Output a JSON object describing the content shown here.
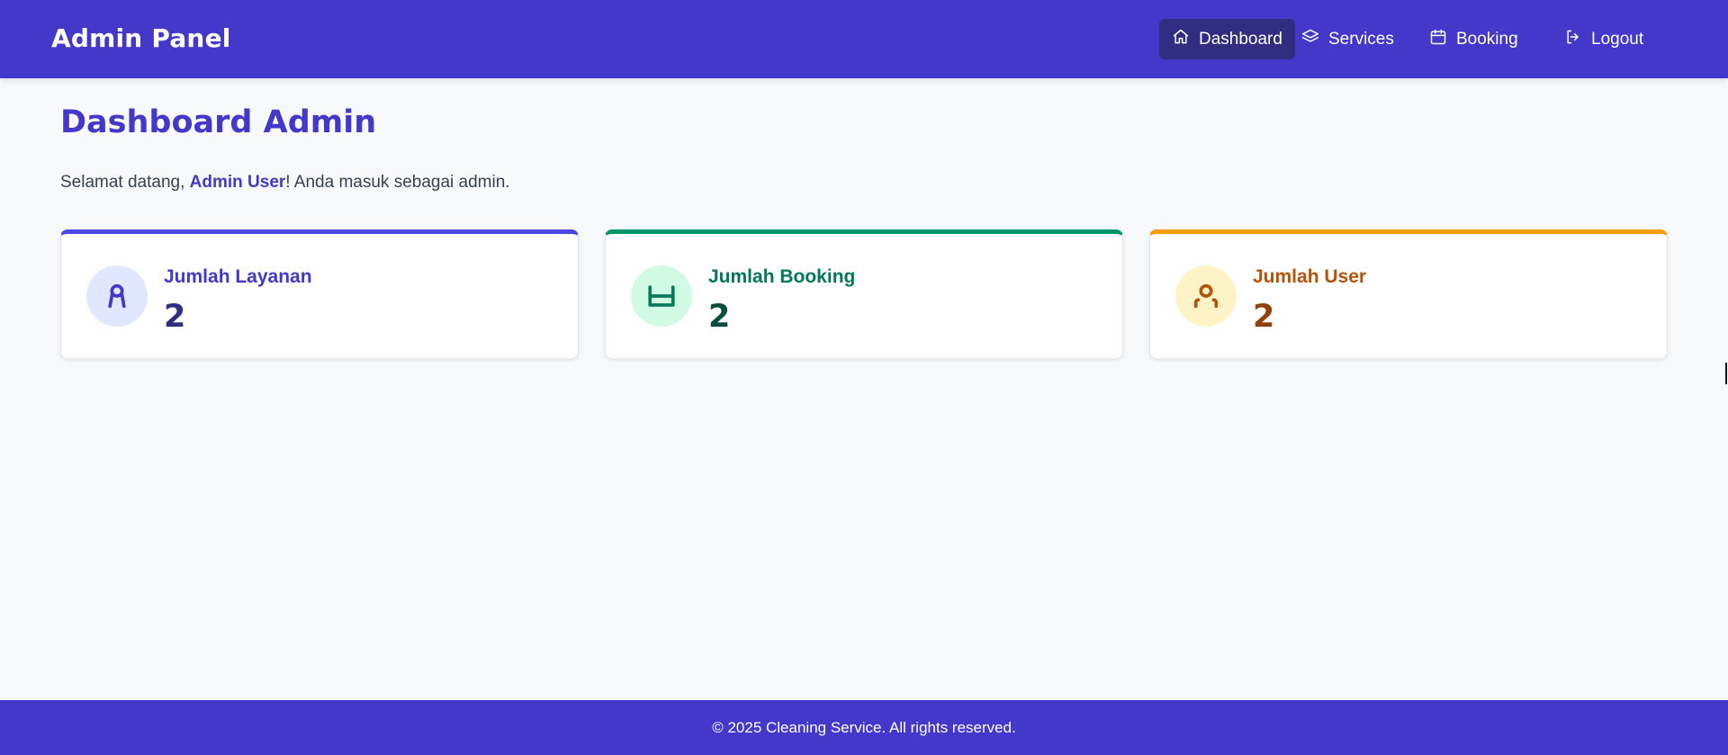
{
  "header": {
    "brand": "Admin Panel",
    "nav": [
      {
        "label": "Dashboard",
        "icon": "home-icon",
        "active": true
      },
      {
        "label": "Services",
        "icon": "layers-icon",
        "active": false
      },
      {
        "label": "Booking",
        "icon": "calendar-icon",
        "active": false
      },
      {
        "label": "Logout",
        "icon": "logout-icon",
        "active": false
      }
    ]
  },
  "main": {
    "title": "Dashboard Admin",
    "welcome": {
      "prefix": "Selamat datang, ",
      "user": "Admin User",
      "suffix": "! Anda masuk sebagai admin."
    },
    "cards": [
      {
        "label": "Jumlah Layanan",
        "value": "2",
        "icon": "service-icon",
        "accent": "#4f46e5",
        "label_color": "#4338ca",
        "value_color": "#312e81",
        "icon_bg": "#e0e7ff"
      },
      {
        "label": "Jumlah Booking",
        "value": "2",
        "icon": "booking-icon",
        "accent": "#059669",
        "label_color": "#047857",
        "value_color": "#064e3b",
        "icon_bg": "#d1fae5"
      },
      {
        "label": "Jumlah User",
        "value": "2",
        "icon": "user-icon",
        "accent": "#f59e0b",
        "label_color": "#b45309",
        "value_color": "#92400e",
        "icon_bg": "#fef3c7"
      }
    ]
  },
  "footer": {
    "text": "© 2025 Cleaning Service. All rights reserved."
  },
  "colors": {
    "primary": "#4338ca",
    "active_nav": "#312e81",
    "background": "#f8f9fb"
  }
}
